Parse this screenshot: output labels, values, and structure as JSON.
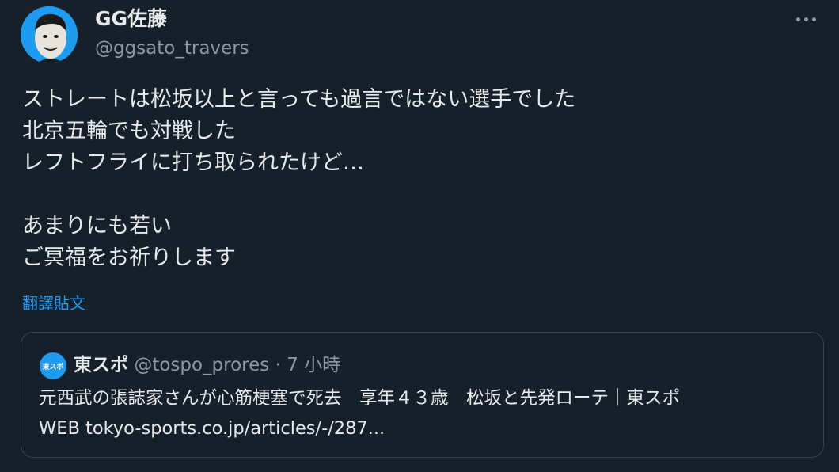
{
  "author": {
    "display_name": "GG佐藤",
    "handle": "@ggsato_travers",
    "avatar_icon": "user-avatar-icon"
  },
  "menu": {
    "more_icon": "more-horizontal-icon"
  },
  "tweet": {
    "lines": [
      "ストレートは松坂以上と言っても過言ではない選手でした",
      "北京五輪でも対戦した",
      "レフトフライに打ち取られたけど…",
      "",
      "あまりにも若い",
      "ご冥福をお祈りします"
    ],
    "translate_label": "翻譯貼文"
  },
  "quote": {
    "avatar_icon": "tospo-avatar-icon",
    "avatar_text": "東スポ",
    "name": "東スポ",
    "handle": "@tospo_prores",
    "separator": "·",
    "time": "7 小時",
    "text_line1": "元西武の張誌家さんが心筋梗塞で死去　享年４３歳　松坂と先発ローテ｜東スポ",
    "text_line2": "WEB tokyo-sports.co.jp/articles/-/287..."
  },
  "colors": {
    "background": "#15202b",
    "text_primary": "#e7e9ea",
    "text_secondary": "#8b98a5",
    "link": "#1d9bf0",
    "border": "#38444d"
  }
}
